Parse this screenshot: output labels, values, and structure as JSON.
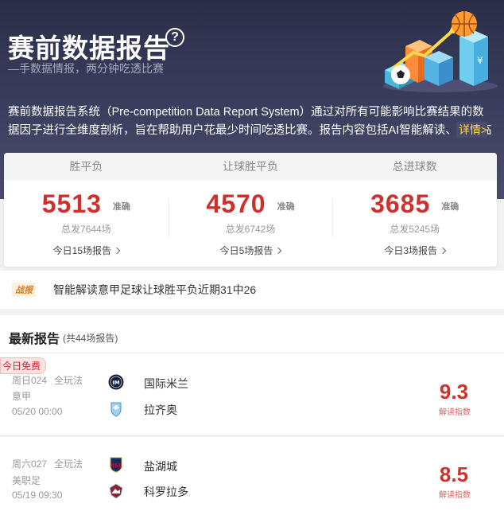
{
  "hero": {
    "title": "赛前数据报告",
    "help_glyph": "?",
    "subtitle": "—手数据情报，两分钟吃透比赛",
    "description": "赛前数据报告系统（Pre-competition Data Report System）通过对所有可能影响比赛结果的数据因子进行全维度剖析，旨在帮助用户花最少时间吃透比赛。报告内容包括AI智能解读、独家临场",
    "detail_link": "详情>"
  },
  "stats": {
    "tabs": [
      "胜平负",
      "让球胜平负",
      "总进球数"
    ],
    "items": [
      {
        "count": "5513",
        "accuracy": "准确",
        "total": "总发7644场",
        "today": "今日15场报告"
      },
      {
        "count": "4570",
        "accuracy": "准确",
        "total": "总发6742场",
        "today": "今日5场报告"
      },
      {
        "count": "3685",
        "accuracy": "准确",
        "total": "总发5245场",
        "today": "今日3场报告"
      }
    ]
  },
  "news": {
    "badge": "战报",
    "text": "智能解读意甲足球让球胜平负近期31中26"
  },
  "list": {
    "title": "最新报告",
    "count": "(共44场报告)",
    "matches": [
      {
        "free_badge": "今日免费",
        "match_no": "周日024",
        "play": "全玩法",
        "league": "意甲",
        "time": "05/20 00:00",
        "home": "国际米兰",
        "away": "拉齐奥",
        "score": "9.3",
        "score_label": "解读指数"
      },
      {
        "match_no": "周六027",
        "play": "全玩法",
        "league": "美职足",
        "time": "05/19 09:30",
        "home": "盐湖城",
        "away": "科罗拉多",
        "score": "8.5",
        "score_label": "解读指数"
      }
    ]
  },
  "colors": {
    "hero_bg": "#3b3f5f",
    "accent_red": "#d0302c",
    "link_yellow": "#ffd84a",
    "badge_orange": "#e07a18"
  }
}
